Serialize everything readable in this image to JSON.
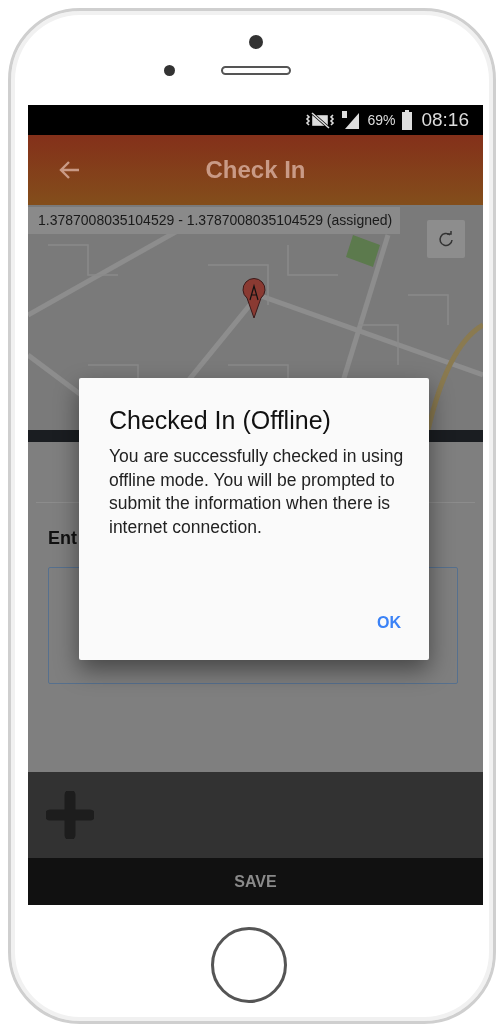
{
  "status_bar": {
    "battery": "69%",
    "time": "08:16"
  },
  "app_bar": {
    "title": "Check In"
  },
  "map": {
    "coordinates": "1.3787008035104529 - 1.3787008035104529 (assigned)"
  },
  "form": {
    "field_label": "Ent"
  },
  "save_button": "SAVE",
  "dialog": {
    "title": "Checked In (Offline)",
    "message": "You are successfully checked in using offline mode. You will be prompted to submit the information when there is internet connection.",
    "button": "OK"
  }
}
